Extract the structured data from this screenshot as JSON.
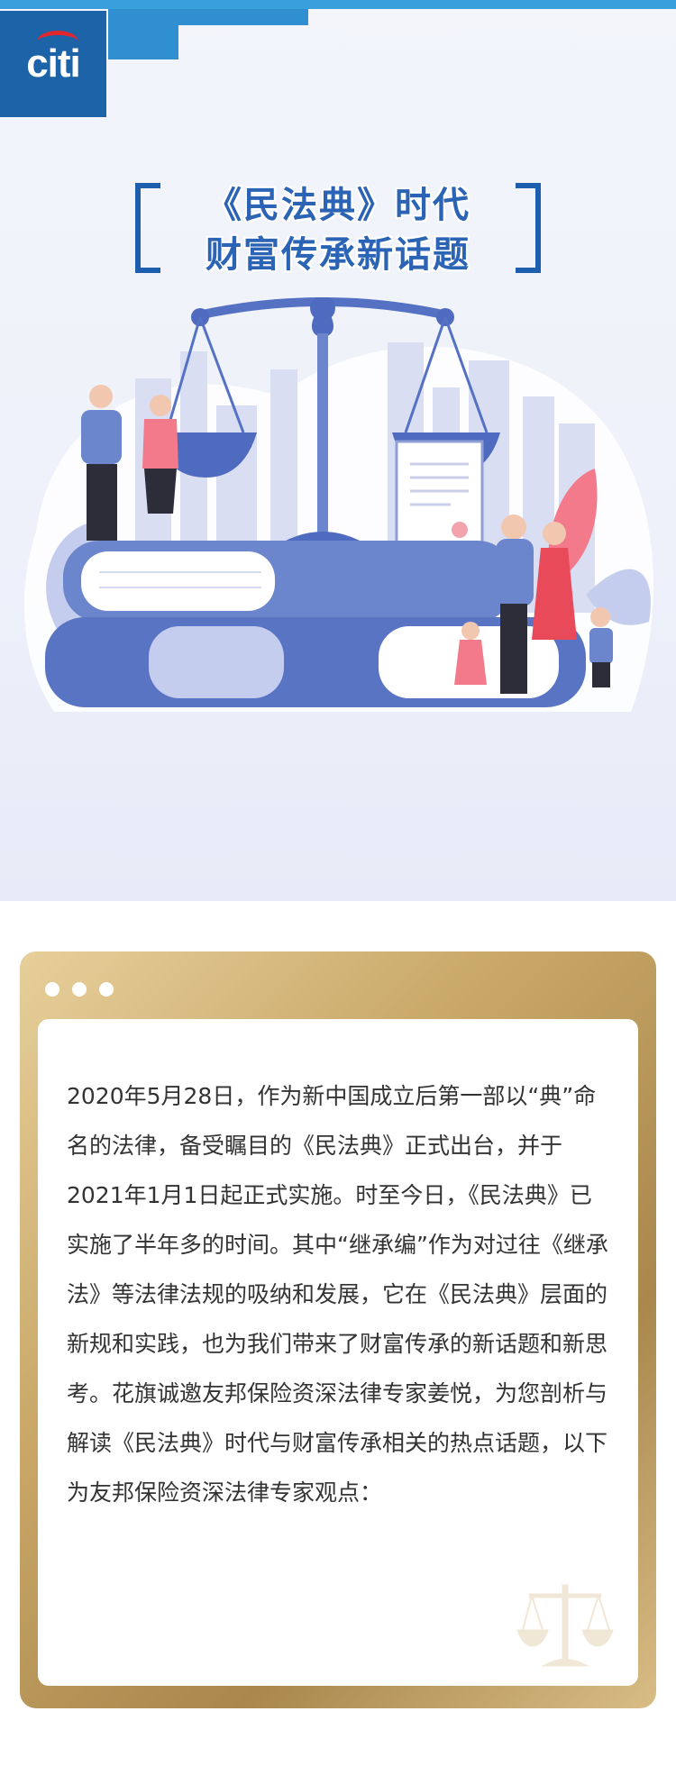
{
  "brand": {
    "logo_text": "citi"
  },
  "header": {
    "title_line1": "《民法典》时代",
    "title_line2": "财富传承新话题"
  },
  "article": {
    "paragraph": "2020年5月28日，作为新中国成立后第一部以“典”命名的法律，备受瞩目的《民法典》正式出台，并于2021年1月1日起正式实施。时至今日，《民法典》已实施了半年多的时间。其中“继承编”作为对过往《继承法》等法律法规的吸纳和发展，它在《民法典》层面的新规和实践，也为我们带来了财富传承的新话题和新思考。花旗诚邀友邦保险资深法律专家姜悦，为您剖析与解读《民法典》时代与财富传承相关的热点话题，以下为友邦保险资深法律专家观点："
  },
  "colors": {
    "brand_blue": "#1d63a8",
    "accent_blue": "#3aa0dc",
    "title_blue": "#2b63b5",
    "gold": "#c9a869",
    "illustration_blue": "#6b86cc",
    "illustration_pink": "#f27a8a"
  },
  "icons": {
    "logo": "citi-logo",
    "hero": "scales-of-justice-icon",
    "watermark": "scales-watermark-icon",
    "dots": "window-dots-icon"
  }
}
